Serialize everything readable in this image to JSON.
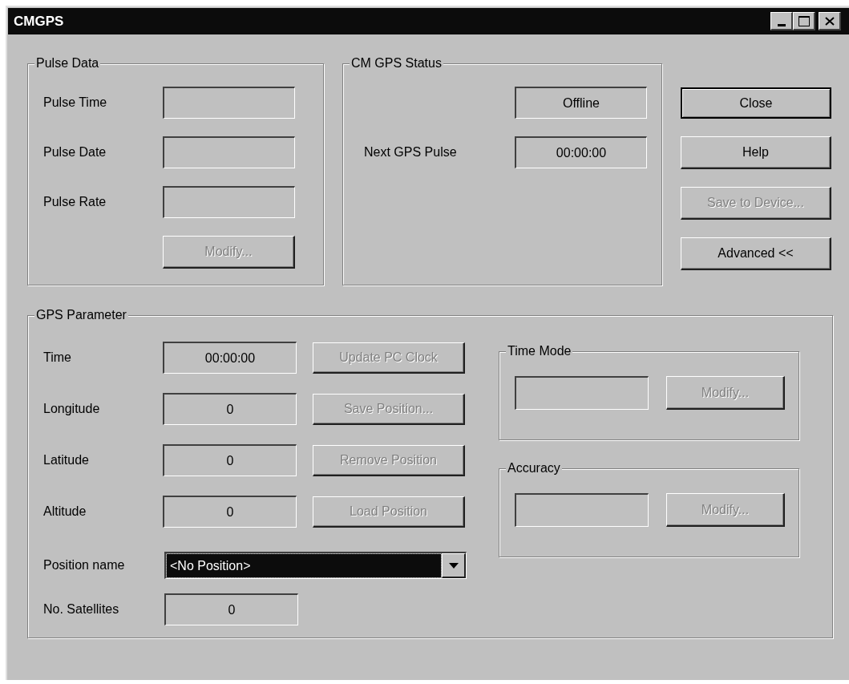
{
  "window": {
    "title": "CMGPS"
  },
  "pulse_data": {
    "title": "Pulse Data",
    "fields": [
      {
        "label": "Pulse Time"
      },
      {
        "label": "Pulse Date"
      },
      {
        "label": "Pulse Rate"
      }
    ],
    "button": {
      "label": "Modify...",
      "disabled": true
    }
  },
  "cm_gps_status": {
    "title": "CM GPS Status",
    "rows": [
      {
        "value": "Offline"
      },
      {
        "label": "Next GPS Pulse",
        "value": "00:00:00"
      }
    ]
  },
  "buttons": [
    {
      "label": "Close",
      "default": true,
      "disabled": false
    },
    {
      "label": "Help",
      "default": false,
      "disabled": false
    },
    {
      "label": "Save to Device...",
      "default": false,
      "disabled": true
    },
    {
      "label": "Advanced <<",
      "default": false,
      "disabled": false
    }
  ],
  "gps_parameter": {
    "title": "GPS Parameter",
    "rows": [
      {
        "label": "Time",
        "value": "00:00:00",
        "button": {
          "label": "Update PC Clock",
          "disabled": true
        }
      },
      {
        "label": "Longitude",
        "value": "0",
        "button": {
          "label": "Save Position...",
          "disabled": true
        }
      },
      {
        "label": "Latitude",
        "value": "0",
        "button": {
          "label": "Remove Position",
          "disabled": true
        }
      },
      {
        "label": "Altitude",
        "value": "0",
        "button": {
          "label": "Load Position",
          "disabled": true
        }
      }
    ],
    "position_name": {
      "label": "Position name",
      "value": "<No Position>",
      "focused": true
    },
    "satellites": {
      "label": "No. Satellites",
      "value": "0"
    },
    "time_mode": {
      "title": "Time Mode",
      "button": {
        "label": "Modify...",
        "disabled": true
      }
    },
    "accuracy": {
      "title": "Accuracy",
      "button": {
        "label": "Modify...",
        "disabled": true
      }
    }
  }
}
